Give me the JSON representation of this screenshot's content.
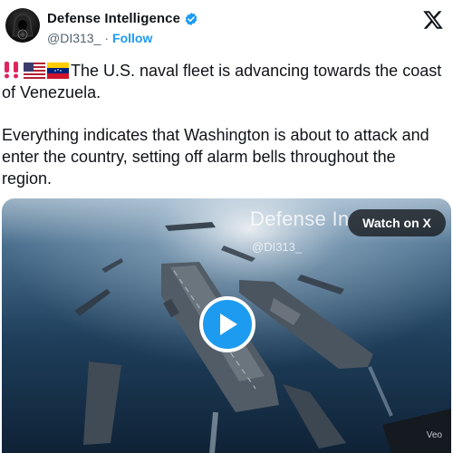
{
  "author": {
    "display_name": "Defense Intelligence",
    "handle": "@DI313_",
    "separator": "·",
    "follow_label": "Follow"
  },
  "tweet": {
    "paragraph_1": "The U.S. naval fleet is advancing towards the coast of Venezuela.",
    "paragraph_2": "Everything indicates that Washington is about to attack and enter the country, setting off alarm bells throughout the region.",
    "emojis": [
      "double-exclamation-icon",
      "us-flag-icon",
      "venezuela-flag-icon"
    ]
  },
  "media": {
    "watermark_title": "Defense In",
    "watermark_handle": "@DI313_",
    "watch_label": "Watch on X",
    "corner_label": "Veo"
  },
  "colors": {
    "accent": "#1d9bf0",
    "text": "#0f1419",
    "secondary": "#536471"
  }
}
